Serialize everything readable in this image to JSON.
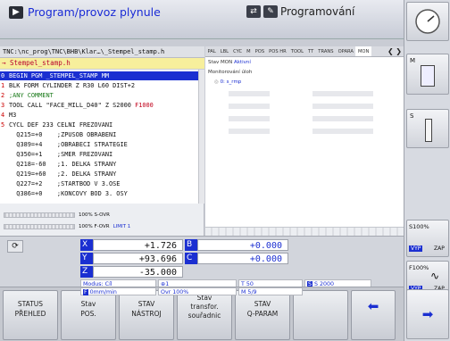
{
  "header": {
    "mode_left": "Program/provoz plynule",
    "mode_right": "Programování"
  },
  "path": "TNC:\\nc_prog\\TNC\\BHB\\Klar…\\_Stempel_stamp.h",
  "file": "→ Stempel_stamp.h",
  "program": [
    {
      "n": "0",
      "text": "BEGIN PGM _STEMPEL_STAMP MM",
      "sel": true
    },
    {
      "n": "1",
      "text": "BLK FORM CYLINDER Z R30 L60 DIST+2"
    },
    {
      "n": "2",
      "text": ";ANY COMMENT",
      "cls": "c-green"
    },
    {
      "n": "3",
      "text": "TOOL CALL \"FACE_MILL_D40\" Z S2000 ",
      "tail": "F1000"
    },
    {
      "n": "4",
      "text": "M3"
    },
    {
      "n": "5",
      "text": "CYCL DEF 233 CELNI FREZOVANI"
    },
    {
      "n": "",
      "text": "  Q215=+0    ;ZPUSOB OBRABENI"
    },
    {
      "n": "",
      "text": "  Q389=+4    ;OBRABECI STRATEGIE"
    },
    {
      "n": "",
      "text": "  Q350=+1    ;SMER FREZOVANI"
    },
    {
      "n": "",
      "text": "  Q218=-60   ;1. DELKA STRANY"
    },
    {
      "n": "",
      "text": "  Q219=+60   ;2. DELKA STRANY"
    },
    {
      "n": "",
      "text": "  Q227=+2    ;STARTBOD V 3.OSE"
    },
    {
      "n": "",
      "text": "  Q386=+0    ;KONCOVY BOD 3. OSY"
    }
  ],
  "override": {
    "s_ovr": "100% S-OVR",
    "f_ovr": "100% F-OVR",
    "limit": "LIMIT 1"
  },
  "tabs": [
    "PAL",
    "LBL",
    "CYC",
    "M",
    "POS",
    "POS HR",
    "TOOL",
    "TT",
    "TRANS",
    "OPARA",
    "MON"
  ],
  "status_panel": {
    "state_label": "Stav MON",
    "state_value": "Aktivní",
    "monitor_title": "Monitorování úloh",
    "task": "0: s_rmp"
  },
  "axes": [
    {
      "name": "X",
      "value": "+1.726"
    },
    {
      "name": "Y",
      "value": "+93.696"
    },
    {
      "name": "Z",
      "value": "-35.000"
    },
    {
      "name": "B",
      "value": "+0.000"
    },
    {
      "name": "C",
      "value": "+0.000"
    }
  ],
  "status_line": {
    "modus": "Modus: Cíl",
    "t_field": "1",
    "feed": "0mm/min",
    "ovr": "Ovr 100%",
    "tool": "T 50",
    "spindle": "S 2000",
    "m": "M 5/9"
  },
  "right": {
    "s100": "S100%",
    "f100": "F100%",
    "vyp1": "VYP",
    "zap1": "ZAP",
    "vyp2": "VYP",
    "zap2": "ZAP"
  },
  "softkeys": [
    {
      "l1": "STATUS",
      "l2": "PŘEHLED"
    },
    {
      "l1": "Stav",
      "l2": "POS."
    },
    {
      "l1": "STAV",
      "l2": "NÁSTROJ"
    },
    {
      "l1": "Stav",
      "l2": "transfor.",
      "l3": "souřadnic"
    },
    {
      "l1": "STAV",
      "l2": "Q-PARAM"
    }
  ],
  "colors": {
    "accent": "#1b2fd1",
    "highlight": "#f7ef9c"
  }
}
